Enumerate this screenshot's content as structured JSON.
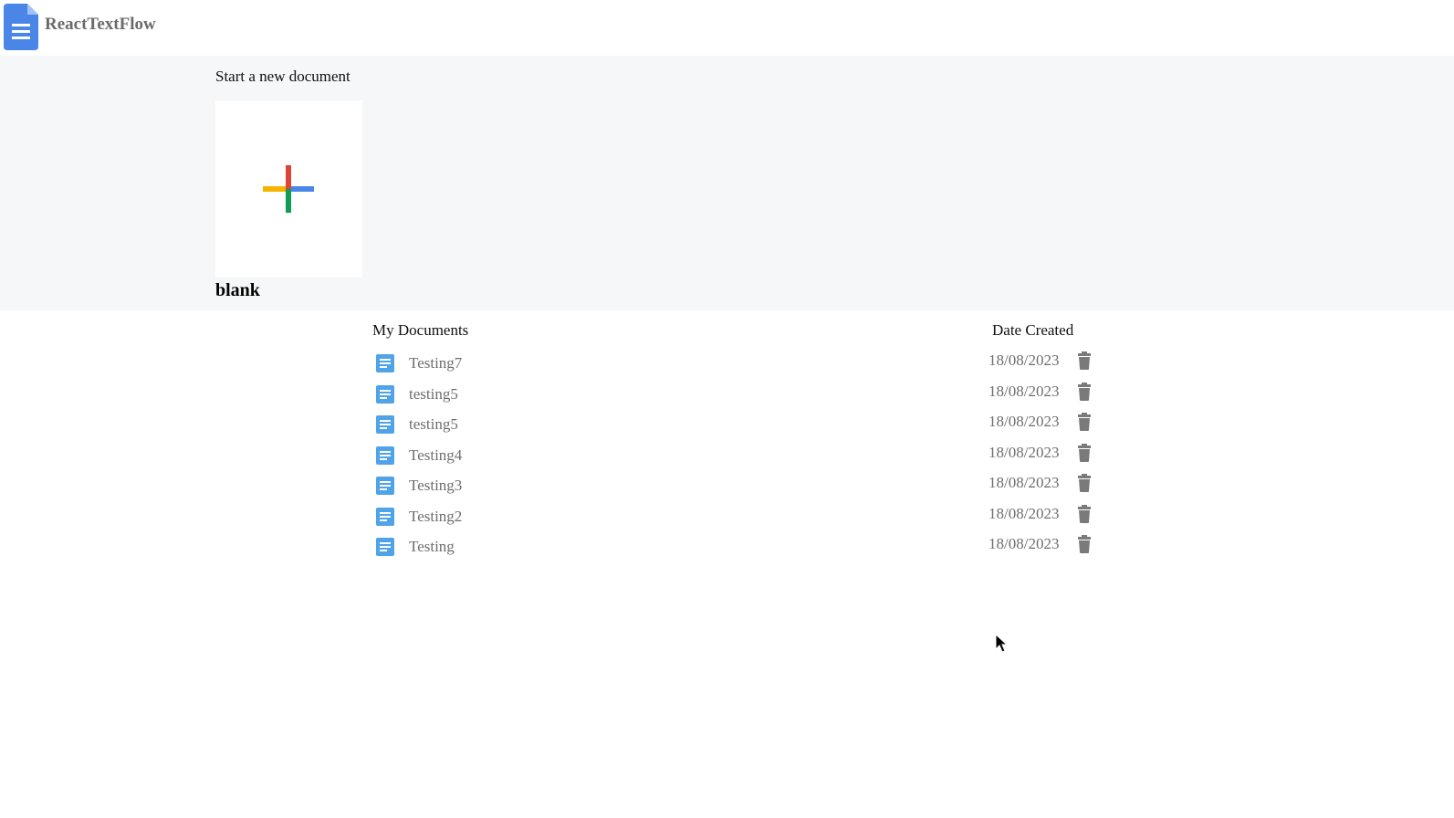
{
  "header": {
    "app_title": "ReactTextFlow",
    "logo_icon": "google-docs-icon",
    "brand_color": "#4a86e8"
  },
  "start": {
    "title": "Start a new document",
    "blank_label": "blank",
    "plus_colors": [
      "#db4437",
      "#4a86e8",
      "#0f9d58",
      "#f4b400"
    ]
  },
  "documents": {
    "header_name": "My Documents",
    "header_date": "Date Created",
    "rows": [
      {
        "name": "Testing7",
        "date": "18/08/2023"
      },
      {
        "name": "testing5",
        "date": "18/08/2023"
      },
      {
        "name": "testing5",
        "date": "18/08/2023"
      },
      {
        "name": "Testing4",
        "date": "18/08/2023"
      },
      {
        "name": "Testing3",
        "date": "18/08/2023"
      },
      {
        "name": "Testing2",
        "date": "18/08/2023"
      },
      {
        "name": "Testing",
        "date": "18/08/2023"
      }
    ],
    "row_icon": "document-icon",
    "action_icon": "trash-icon",
    "doc_icon_color": "#4fa3e8"
  }
}
